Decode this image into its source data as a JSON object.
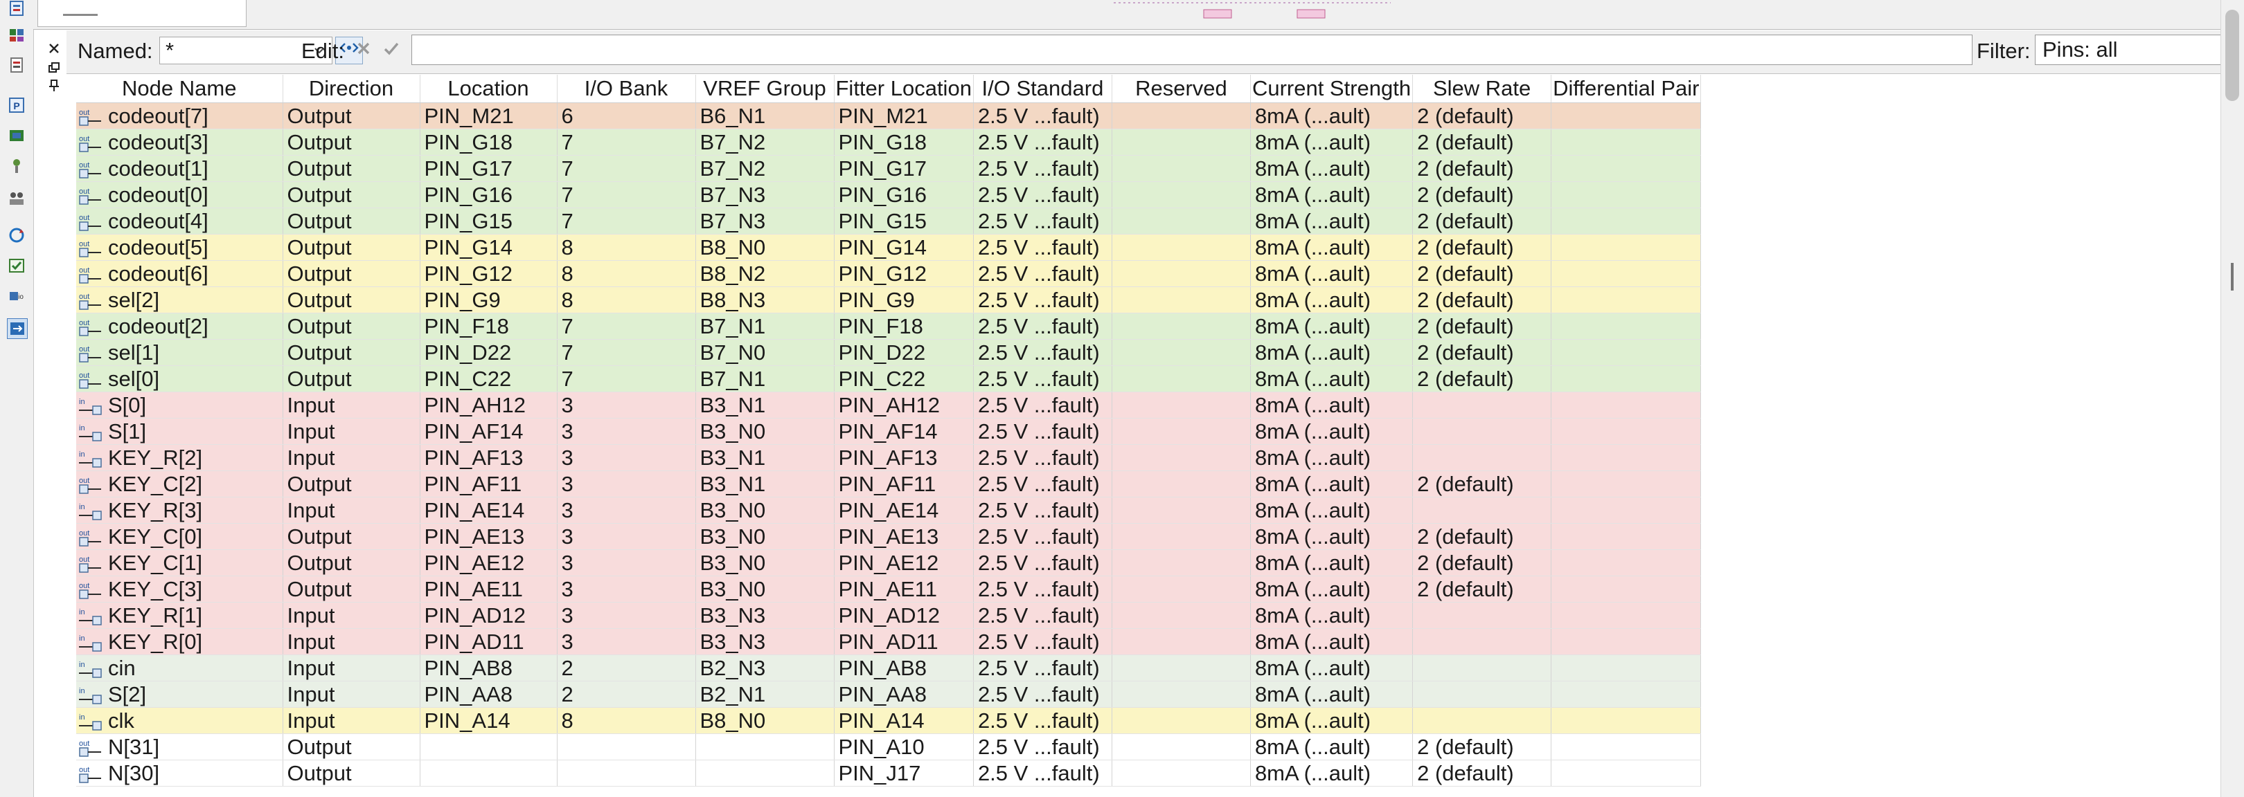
{
  "toolbar": {
    "icons": [
      "report-icon",
      "assignment-icon",
      "tasks-icon",
      "pin-planner-icon",
      "chip-planner-icon",
      "probe-icon",
      "people-icon",
      "refresh-icon",
      "check-icon",
      "io-icon",
      "swap-icon"
    ]
  },
  "filter_bar": {
    "named_label": "Named:",
    "named_value": "*",
    "edit_label": "Edit:",
    "edit_value": "",
    "filter_label": "Filter:",
    "filter_value": "Pins: all"
  },
  "table": {
    "columns": [
      "Node Name",
      "Direction",
      "Location",
      "I/O Bank",
      "VREF Group",
      "Fitter Location",
      "I/O Standard",
      "Reserved",
      "Current Strength",
      "Slew Rate",
      "Differential Pair"
    ],
    "rows": [
      {
        "icon": "output-pin-icon",
        "highlight": "orange",
        "cells": [
          "codeout[7]",
          "Output",
          "PIN_M21",
          "6",
          "B6_N1",
          "PIN_M21",
          "2.5 V ...fault)",
          "",
          "8mA (...ault)",
          "2 (default)",
          ""
        ]
      },
      {
        "icon": "output-pin-icon",
        "highlight": "green",
        "cells": [
          "codeout[3]",
          "Output",
          "PIN_G18",
          "7",
          "B7_N2",
          "PIN_G18",
          "2.5 V ...fault)",
          "",
          "8mA (...ault)",
          "2 (default)",
          ""
        ]
      },
      {
        "icon": "output-pin-icon",
        "highlight": "green",
        "cells": [
          "codeout[1]",
          "Output",
          "PIN_G17",
          "7",
          "B7_N2",
          "PIN_G17",
          "2.5 V ...fault)",
          "",
          "8mA (...ault)",
          "2 (default)",
          ""
        ]
      },
      {
        "icon": "output-pin-icon",
        "highlight": "green",
        "cells": [
          "codeout[0]",
          "Output",
          "PIN_G16",
          "7",
          "B7_N3",
          "PIN_G16",
          "2.5 V ...fault)",
          "",
          "8mA (...ault)",
          "2 (default)",
          ""
        ]
      },
      {
        "icon": "output-pin-icon",
        "highlight": "green",
        "cells": [
          "codeout[4]",
          "Output",
          "PIN_G15",
          "7",
          "B7_N3",
          "PIN_G15",
          "2.5 V ...fault)",
          "",
          "8mA (...ault)",
          "2 (default)",
          ""
        ]
      },
      {
        "icon": "output-pin-icon",
        "highlight": "yellow",
        "cells": [
          "codeout[5]",
          "Output",
          "PIN_G14",
          "8",
          "B8_N0",
          "PIN_G14",
          "2.5 V ...fault)",
          "",
          "8mA (...ault)",
          "2 (default)",
          ""
        ]
      },
      {
        "icon": "output-pin-icon",
        "highlight": "yellow",
        "cells": [
          "codeout[6]",
          "Output",
          "PIN_G12",
          "8",
          "B8_N2",
          "PIN_G12",
          "2.5 V ...fault)",
          "",
          "8mA (...ault)",
          "2 (default)",
          ""
        ]
      },
      {
        "icon": "output-pin-icon",
        "highlight": "yellow",
        "cells": [
          "sel[2]",
          "Output",
          "PIN_G9",
          "8",
          "B8_N3",
          "PIN_G9",
          "2.5 V ...fault)",
          "",
          "8mA (...ault)",
          "2 (default)",
          ""
        ]
      },
      {
        "icon": "output-pin-icon",
        "highlight": "green",
        "cells": [
          "codeout[2]",
          "Output",
          "PIN_F18",
          "7",
          "B7_N1",
          "PIN_F18",
          "2.5 V ...fault)",
          "",
          "8mA (...ault)",
          "2 (default)",
          ""
        ]
      },
      {
        "icon": "output-pin-icon",
        "highlight": "green",
        "cells": [
          "sel[1]",
          "Output",
          "PIN_D22",
          "7",
          "B7_N0",
          "PIN_D22",
          "2.5 V ...fault)",
          "",
          "8mA (...ault)",
          "2 (default)",
          ""
        ]
      },
      {
        "icon": "output-pin-icon",
        "highlight": "green",
        "cells": [
          "sel[0]",
          "Output",
          "PIN_C22",
          "7",
          "B7_N1",
          "PIN_C22",
          "2.5 V ...fault)",
          "",
          "8mA (...ault)",
          "2 (default)",
          ""
        ]
      },
      {
        "icon": "input-pin-icon",
        "highlight": "red",
        "cells": [
          "S[0]",
          "Input",
          "PIN_AH12",
          "3",
          "B3_N1",
          "PIN_AH12",
          "2.5 V ...fault)",
          "",
          "8mA (...ault)",
          "",
          ""
        ]
      },
      {
        "icon": "input-pin-icon",
        "highlight": "red",
        "cells": [
          "S[1]",
          "Input",
          "PIN_AF14",
          "3",
          "B3_N0",
          "PIN_AF14",
          "2.5 V ...fault)",
          "",
          "8mA (...ault)",
          "",
          ""
        ]
      },
      {
        "icon": "input-pin-icon",
        "highlight": "red",
        "cells": [
          "KEY_R[2]",
          "Input",
          "PIN_AF13",
          "3",
          "B3_N1",
          "PIN_AF13",
          "2.5 V ...fault)",
          "",
          "8mA (...ault)",
          "",
          ""
        ]
      },
      {
        "icon": "output-pin-icon",
        "highlight": "red",
        "cells": [
          "KEY_C[2]",
          "Output",
          "PIN_AF11",
          "3",
          "B3_N1",
          "PIN_AF11",
          "2.5 V ...fault)",
          "",
          "8mA (...ault)",
          "2 (default)",
          ""
        ]
      },
      {
        "icon": "input-pin-icon",
        "highlight": "red",
        "cells": [
          "KEY_R[3]",
          "Input",
          "PIN_AE14",
          "3",
          "B3_N0",
          "PIN_AE14",
          "2.5 V ...fault)",
          "",
          "8mA (...ault)",
          "",
          ""
        ]
      },
      {
        "icon": "output-pin-icon",
        "highlight": "red",
        "cells": [
          "KEY_C[0]",
          "Output",
          "PIN_AE13",
          "3",
          "B3_N0",
          "PIN_AE13",
          "2.5 V ...fault)",
          "",
          "8mA (...ault)",
          "2 (default)",
          ""
        ]
      },
      {
        "icon": "output-pin-icon",
        "highlight": "red",
        "cells": [
          "KEY_C[1]",
          "Output",
          "PIN_AE12",
          "3",
          "B3_N0",
          "PIN_AE12",
          "2.5 V ...fault)",
          "",
          "8mA (...ault)",
          "2 (default)",
          ""
        ]
      },
      {
        "icon": "output-pin-icon",
        "highlight": "red",
        "cells": [
          "KEY_C[3]",
          "Output",
          "PIN_AE11",
          "3",
          "B3_N0",
          "PIN_AE11",
          "2.5 V ...fault)",
          "",
          "8mA (...ault)",
          "2 (default)",
          ""
        ]
      },
      {
        "icon": "input-pin-icon",
        "highlight": "red",
        "cells": [
          "KEY_R[1]",
          "Input",
          "PIN_AD12",
          "3",
          "B3_N3",
          "PIN_AD12",
          "2.5 V ...fault)",
          "",
          "8mA (...ault)",
          "",
          ""
        ]
      },
      {
        "icon": "input-pin-icon",
        "highlight": "red",
        "cells": [
          "KEY_R[0]",
          "Input",
          "PIN_AD11",
          "3",
          "B3_N3",
          "PIN_AD11",
          "2.5 V ...fault)",
          "",
          "8mA (...ault)",
          "",
          ""
        ]
      },
      {
        "icon": "input-pin-icon",
        "highlight": "gray",
        "cells": [
          "cin",
          "Input",
          "PIN_AB8",
          "2",
          "B2_N3",
          "PIN_AB8",
          "2.5 V ...fault)",
          "",
          "8mA (...ault)",
          "",
          ""
        ]
      },
      {
        "icon": "input-pin-icon",
        "highlight": "gray",
        "cells": [
          "S[2]",
          "Input",
          "PIN_AA8",
          "2",
          "B2_N1",
          "PIN_AA8",
          "2.5 V ...fault)",
          "",
          "8mA (...ault)",
          "",
          ""
        ]
      },
      {
        "icon": "input-pin-icon",
        "highlight": "yellow",
        "cells": [
          "clk",
          "Input",
          "PIN_A14",
          "8",
          "B8_N0",
          "PIN_A14",
          "2.5 V ...fault)",
          "",
          "8mA (...ault)",
          "",
          ""
        ]
      },
      {
        "icon": "output-pin-icon",
        "highlight": "white",
        "cells": [
          "N[31]",
          "Output",
          "",
          "",
          "",
          "PIN_A10",
          "2.5 V ...fault)",
          "",
          "8mA (...ault)",
          "2 (default)",
          ""
        ]
      },
      {
        "icon": "output-pin-icon",
        "highlight": "white",
        "cells": [
          "N[30]",
          "Output",
          "",
          "",
          "",
          "PIN_J17",
          "2.5 V ...fault)",
          "",
          "8mA (...ault)",
          "2 (default)",
          ""
        ]
      }
    ]
  },
  "colors": {
    "orange": "#f3d8c4",
    "green": "#dff0d2",
    "yellow": "#fbf5c4",
    "red": "#f8dcdc",
    "gray": "#e9f0e6",
    "white": "#ffffff"
  }
}
